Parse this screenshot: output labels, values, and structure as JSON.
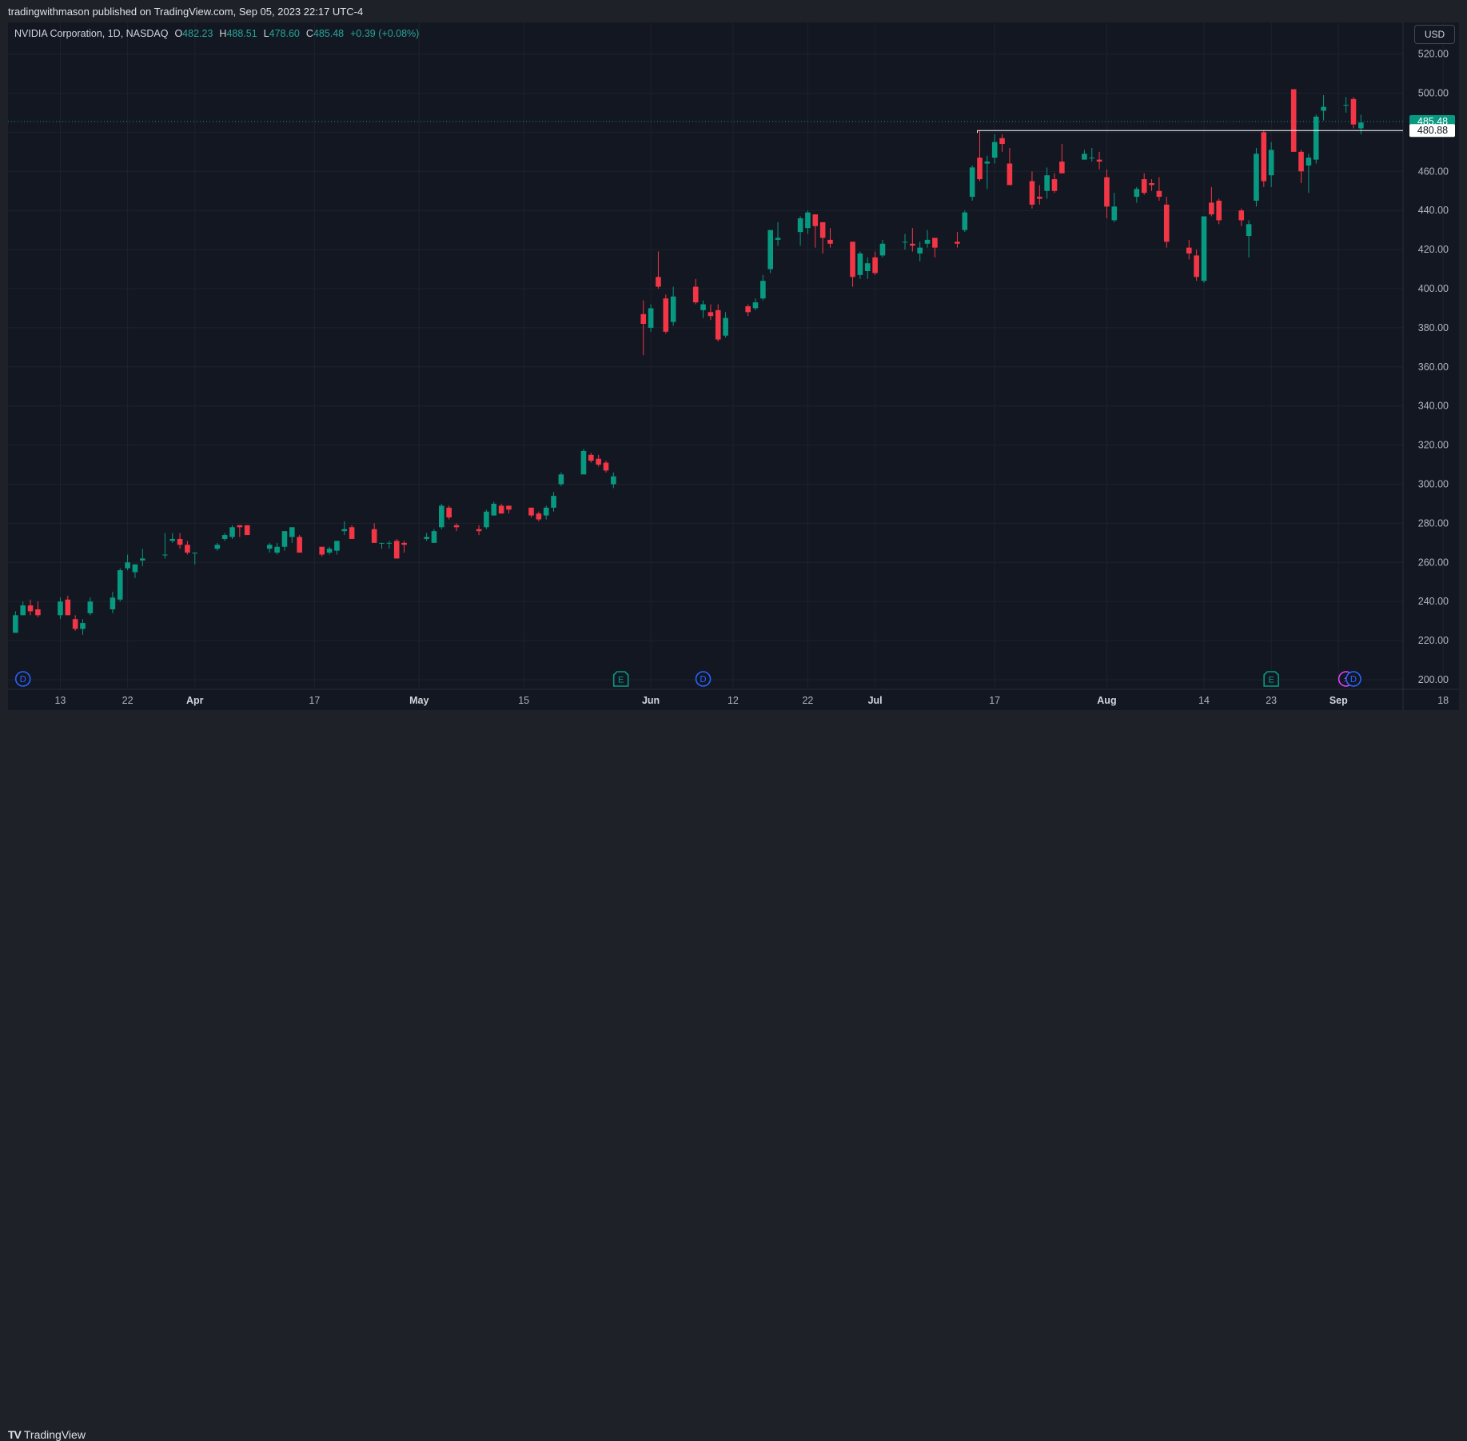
{
  "header": {
    "published_text": "tradingwithmason published on TradingView.com, Sep 05, 2023 22:17 UTC-4"
  },
  "legend": {
    "symbol": "NVIDIA Corporation, 1D, NASDAQ",
    "o_label": "O",
    "o_value": "482.23",
    "h_label": "H",
    "h_value": "488.51",
    "l_label": "L",
    "l_value": "478.60",
    "c_label": "C",
    "c_value": "485.48",
    "change": "+0.39 (+0.08%)"
  },
  "currency_button": "USD",
  "footer": {
    "brand": "TradingView",
    "logo_icon": "tradingview-logo-icon"
  },
  "colors": {
    "up": "#089981",
    "down": "#f23645",
    "background": "#131722",
    "grid": "#232632",
    "text": "#b2b5be",
    "dividend_marker": "#2962ff",
    "earnings_marker": "#089981",
    "split_marker": "#e040fb"
  },
  "chart_data": {
    "type": "candlestick",
    "title": "NVIDIA Corporation, 1D, NASDAQ",
    "currency": "USD",
    "ylim": [
      195,
      530
    ],
    "y_ticks": [
      "520.00",
      "500.00",
      "480.00",
      "460.00",
      "440.00",
      "420.00",
      "400.00",
      "380.00",
      "360.00",
      "340.00",
      "320.00",
      "300.00",
      "280.00",
      "260.00",
      "240.00",
      "220.00",
      "200.00"
    ],
    "x_ticks": [
      {
        "label": "13",
        "day": 7
      },
      {
        "label": "22",
        "day": 16
      },
      {
        "label": "Apr",
        "day": 25
      },
      {
        "label": "17",
        "day": 41
      },
      {
        "label": "May",
        "day": 55
      },
      {
        "label": "15",
        "day": 69
      },
      {
        "label": "Jun",
        "day": 86
      },
      {
        "label": "12",
        "day": 97
      },
      {
        "label": "22",
        "day": 107
      },
      {
        "label": "Jul",
        "day": 116
      },
      {
        "label": "17",
        "day": 132
      },
      {
        "label": "Aug",
        "day": 147
      },
      {
        "label": "14",
        "day": 160
      },
      {
        "label": "23",
        "day": 169
      },
      {
        "label": "Sep",
        "day": 178
      },
      {
        "label": "18",
        "day": 192
      }
    ],
    "candles": [
      {
        "d": 1,
        "o": 224,
        "h": 235,
        "l": 224,
        "c": 233
      },
      {
        "d": 2,
        "o": 233,
        "h": 240,
        "l": 233,
        "c": 238
      },
      {
        "d": 3,
        "o": 238,
        "h": 241,
        "l": 233,
        "c": 235
      },
      {
        "d": 4,
        "o": 236,
        "h": 240,
        "l": 232,
        "c": 233
      },
      {
        "d": 7,
        "o": 233,
        "h": 242,
        "l": 231,
        "c": 240
      },
      {
        "d": 8,
        "o": 241,
        "h": 243,
        "l": 233,
        "c": 233
      },
      {
        "d": 9,
        "o": 231,
        "h": 233,
        "l": 225,
        "c": 226
      },
      {
        "d": 10,
        "o": 226,
        "h": 231,
        "l": 223,
        "c": 229
      },
      {
        "d": 11,
        "o": 234,
        "h": 242,
        "l": 233,
        "c": 240
      },
      {
        "d": 14,
        "o": 236,
        "h": 245,
        "l": 234,
        "c": 242
      },
      {
        "d": 15,
        "o": 241,
        "h": 257,
        "l": 240,
        "c": 256
      },
      {
        "d": 16,
        "o": 257,
        "h": 264,
        "l": 256,
        "c": 260
      },
      {
        "d": 17,
        "o": 255,
        "h": 259,
        "l": 252,
        "c": 259
      },
      {
        "d": 18,
        "o": 261,
        "h": 267,
        "l": 258,
        "c": 262
      },
      {
        "d": 21,
        "o": 264,
        "h": 275,
        "l": 262,
        "c": 264
      },
      {
        "d": 22,
        "o": 271,
        "h": 275,
        "l": 270,
        "c": 272
      },
      {
        "d": 23,
        "o": 272,
        "h": 275,
        "l": 267,
        "c": 269
      },
      {
        "d": 24,
        "o": 269,
        "h": 271,
        "l": 264,
        "c": 265
      },
      {
        "d": 25,
        "o": 265,
        "h": 265,
        "l": 259,
        "c": 265
      },
      {
        "d": 28,
        "o": 267,
        "h": 270,
        "l": 266,
        "c": 269
      },
      {
        "d": 29,
        "o": 272,
        "h": 275,
        "l": 271,
        "c": 274
      },
      {
        "d": 30,
        "o": 273,
        "h": 279,
        "l": 272,
        "c": 278
      },
      {
        "d": 31,
        "o": 279,
        "h": 279,
        "l": 273,
        "c": 278
      },
      {
        "d": 32,
        "o": 279,
        "h": 279,
        "l": 274,
        "c": 274
      },
      {
        "d": 35,
        "o": 267,
        "h": 270,
        "l": 265,
        "c": 269
      },
      {
        "d": 36,
        "o": 265,
        "h": 270,
        "l": 264,
        "c": 268
      },
      {
        "d": 37,
        "o": 268,
        "h": 276,
        "l": 266,
        "c": 276
      },
      {
        "d": 38,
        "o": 273,
        "h": 278,
        "l": 270,
        "c": 278
      },
      {
        "d": 39,
        "o": 273,
        "h": 274,
        "l": 265,
        "c": 265
      },
      {
        "d": 42,
        "o": 268,
        "h": 268,
        "l": 263,
        "c": 264
      },
      {
        "d": 43,
        "o": 265,
        "h": 268,
        "l": 264,
        "c": 267
      },
      {
        "d": 44,
        "o": 266,
        "h": 271,
        "l": 264,
        "c": 271
      },
      {
        "d": 45,
        "o": 276,
        "h": 281,
        "l": 274,
        "c": 277
      },
      {
        "d": 46,
        "o": 278,
        "h": 279,
        "l": 274,
        "c": 272
      },
      {
        "d": 49,
        "o": 277,
        "h": 280,
        "l": 270,
        "c": 270
      },
      {
        "d": 50,
        "o": 270,
        "h": 270,
        "l": 267,
        "c": 270
      },
      {
        "d": 51,
        "o": 270,
        "h": 271,
        "l": 267,
        "c": 270
      },
      {
        "d": 52,
        "o": 271,
        "h": 272,
        "l": 262,
        "c": 262
      },
      {
        "d": 53,
        "o": 270,
        "h": 271,
        "l": 265,
        "c": 269
      },
      {
        "d": 56,
        "o": 272,
        "h": 275,
        "l": 271,
        "c": 273
      },
      {
        "d": 57,
        "o": 270,
        "h": 277,
        "l": 270,
        "c": 276
      },
      {
        "d": 58,
        "o": 278,
        "h": 290,
        "l": 277,
        "c": 289
      },
      {
        "d": 59,
        "o": 288,
        "h": 289,
        "l": 282,
        "c": 283
      },
      {
        "d": 60,
        "o": 279,
        "h": 280,
        "l": 276,
        "c": 278
      },
      {
        "d": 63,
        "o": 277,
        "h": 279,
        "l": 274,
        "c": 276
      },
      {
        "d": 64,
        "o": 278,
        "h": 287,
        "l": 277,
        "c": 286
      },
      {
        "d": 65,
        "o": 284,
        "h": 291,
        "l": 284,
        "c": 290
      },
      {
        "d": 66,
        "o": 289,
        "h": 290,
        "l": 285,
        "c": 285
      },
      {
        "d": 67,
        "o": 289,
        "h": 289,
        "l": 285,
        "c": 287
      },
      {
        "d": 70,
        "o": 288,
        "h": 288,
        "l": 283,
        "c": 284
      },
      {
        "d": 71,
        "o": 285,
        "h": 286,
        "l": 281,
        "c": 282
      },
      {
        "d": 72,
        "o": 284,
        "h": 289,
        "l": 282,
        "c": 288
      },
      {
        "d": 73,
        "o": 288,
        "h": 296,
        "l": 286,
        "c": 294
      },
      {
        "d": 74,
        "o": 300,
        "h": 306,
        "l": 299,
        "c": 305
      },
      {
        "d": 77,
        "o": 305,
        "h": 318,
        "l": 305,
        "c": 317
      },
      {
        "d": 78,
        "o": 315,
        "h": 316,
        "l": 311,
        "c": 312
      },
      {
        "d": 79,
        "o": 313,
        "h": 315,
        "l": 309,
        "c": 310
      },
      {
        "d": 80,
        "o": 311,
        "h": 312,
        "l": 306,
        "c": 307
      },
      {
        "d": 81,
        "o": 300,
        "h": 306,
        "l": 298,
        "c": 304
      },
      {
        "d": 85,
        "o": 387,
        "h": 394,
        "l": 366,
        "c": 382
      },
      {
        "d": 86,
        "o": 380,
        "h": 392,
        "l": 378,
        "c": 390
      },
      {
        "d": 87,
        "o": 406,
        "h": 419,
        "l": 400,
        "c": 401
      },
      {
        "d": 88,
        "o": 395,
        "h": 397,
        "l": 377,
        "c": 378
      },
      {
        "d": 89,
        "o": 383,
        "h": 401,
        "l": 381,
        "c": 396
      },
      {
        "d": 92,
        "o": 401,
        "h": 405,
        "l": 392,
        "c": 393
      },
      {
        "d": 93,
        "o": 389,
        "h": 394,
        "l": 385,
        "c": 392
      },
      {
        "d": 94,
        "o": 388,
        "h": 392,
        "l": 384,
        "c": 386
      },
      {
        "d": 95,
        "o": 389,
        "h": 392,
        "l": 373,
        "c": 374
      },
      {
        "d": 96,
        "o": 376,
        "h": 388,
        "l": 375,
        "c": 385
      },
      {
        "d": 99,
        "o": 391,
        "h": 392,
        "l": 386,
        "c": 388
      },
      {
        "d": 100,
        "o": 390,
        "h": 395,
        "l": 389,
        "c": 393
      },
      {
        "d": 101,
        "o": 395,
        "h": 407,
        "l": 394,
        "c": 404
      },
      {
        "d": 102,
        "o": 410,
        "h": 429,
        "l": 408,
        "c": 430
      },
      {
        "d": 103,
        "o": 425,
        "h": 434,
        "l": 422,
        "c": 426
      },
      {
        "d": 106,
        "o": 429,
        "h": 437,
        "l": 422,
        "c": 436
      },
      {
        "d": 107,
        "o": 431,
        "h": 440,
        "l": 428,
        "c": 439
      },
      {
        "d": 108,
        "o": 438,
        "h": 438,
        "l": 421,
        "c": 432
      },
      {
        "d": 109,
        "o": 434,
        "h": 434,
        "l": 418,
        "c": 426
      },
      {
        "d": 110,
        "o": 425,
        "h": 431,
        "l": 421,
        "c": 423
      },
      {
        "d": 113,
        "o": 424,
        "h": 424,
        "l": 401,
        "c": 406
      },
      {
        "d": 114,
        "o": 407,
        "h": 419,
        "l": 405,
        "c": 418
      },
      {
        "d": 115,
        "o": 409,
        "h": 416,
        "l": 405,
        "c": 413
      },
      {
        "d": 116,
        "o": 416,
        "h": 419,
        "l": 407,
        "c": 408
      },
      {
        "d": 117,
        "o": 417,
        "h": 425,
        "l": 416,
        "c": 423
      },
      {
        "d": 120,
        "o": 424,
        "h": 428,
        "l": 420,
        "c": 424
      },
      {
        "d": 121,
        "o": 423,
        "h": 431,
        "l": 419,
        "c": 422
      },
      {
        "d": 122,
        "o": 418,
        "h": 424,
        "l": 414,
        "c": 421
      },
      {
        "d": 123,
        "o": 423,
        "h": 430,
        "l": 421,
        "c": 425
      },
      {
        "d": 124,
        "o": 426,
        "h": 426,
        "l": 416,
        "c": 421
      },
      {
        "d": 127,
        "o": 424,
        "h": 429,
        "l": 421,
        "c": 423
      },
      {
        "d": 128,
        "o": 430,
        "h": 440,
        "l": 429,
        "c": 439
      },
      {
        "d": 129,
        "o": 447,
        "h": 463,
        "l": 445,
        "c": 462
      },
      {
        "d": 130,
        "o": 467,
        "h": 481,
        "l": 455,
        "c": 456
      },
      {
        "d": 131,
        "o": 464,
        "h": 468,
        "l": 451,
        "c": 465
      },
      {
        "d": 132,
        "o": 467,
        "h": 479,
        "l": 464,
        "c": 475
      },
      {
        "d": 133,
        "o": 477,
        "h": 479,
        "l": 470,
        "c": 474
      },
      {
        "d": 134,
        "o": 464,
        "h": 472,
        "l": 453,
        "c": 453
      },
      {
        "d": 137,
        "o": 455,
        "h": 460,
        "l": 441,
        "c": 443
      },
      {
        "d": 138,
        "o": 447,
        "h": 453,
        "l": 443,
        "c": 446
      },
      {
        "d": 139,
        "o": 450,
        "h": 462,
        "l": 446,
        "c": 458
      },
      {
        "d": 140,
        "o": 456,
        "h": 459,
        "l": 449,
        "c": 450
      },
      {
        "d": 141,
        "o": 465,
        "h": 474,
        "l": 459,
        "c": 459
      },
      {
        "d": 144,
        "o": 466,
        "h": 471,
        "l": 466,
        "c": 469
      },
      {
        "d": 145,
        "o": 467,
        "h": 472,
        "l": 465,
        "c": 467
      },
      {
        "d": 146,
        "o": 466,
        "h": 470,
        "l": 461,
        "c": 465
      },
      {
        "d": 147,
        "o": 457,
        "h": 461,
        "l": 436,
        "c": 442
      },
      {
        "d": 148,
        "o": 435,
        "h": 449,
        "l": 434,
        "c": 442
      },
      {
        "d": 151,
        "o": 447,
        "h": 452,
        "l": 444,
        "c": 451
      },
      {
        "d": 152,
        "o": 456,
        "h": 459,
        "l": 448,
        "c": 449
      },
      {
        "d": 153,
        "o": 454,
        "h": 456,
        "l": 450,
        "c": 453
      },
      {
        "d": 154,
        "o": 450,
        "h": 457,
        "l": 445,
        "c": 447
      },
      {
        "d": 155,
        "o": 443,
        "h": 447,
        "l": 421,
        "c": 424
      },
      {
        "d": 158,
        "o": 421,
        "h": 425,
        "l": 415,
        "c": 418
      },
      {
        "d": 159,
        "o": 417,
        "h": 420,
        "l": 404,
        "c": 406
      },
      {
        "d": 160,
        "o": 404,
        "h": 437,
        "l": 403,
        "c": 437
      },
      {
        "d": 161,
        "o": 444,
        "h": 452,
        "l": 437,
        "c": 438
      },
      {
        "d": 162,
        "o": 445,
        "h": 446,
        "l": 433,
        "c": 435
      },
      {
        "d": 165,
        "o": 440,
        "h": 441,
        "l": 432,
        "c": 435
      },
      {
        "d": 166,
        "o": 427,
        "h": 435,
        "l": 416,
        "c": 433
      },
      {
        "d": 167,
        "o": 445,
        "h": 472,
        "l": 442,
        "c": 469
      },
      {
        "d": 168,
        "o": 480,
        "h": 481,
        "l": 452,
        "c": 455
      },
      {
        "d": 169,
        "o": 458,
        "h": 475,
        "l": 452,
        "c": 471
      },
      {
        "d": 172,
        "o": 502,
        "h": 502,
        "l": 470,
        "c": 470
      },
      {
        "d": 173,
        "o": 470,
        "h": 471,
        "l": 454,
        "c": 460
      },
      {
        "d": 174,
        "o": 463,
        "h": 469,
        "l": 449,
        "c": 467
      },
      {
        "d": 175,
        "o": 466,
        "h": 489,
        "l": 464,
        "c": 488
      },
      {
        "d": 176,
        "o": 491,
        "h": 499,
        "l": 486,
        "c": 493
      },
      {
        "d": 179,
        "o": 494,
        "h": 498,
        "l": 490,
        "c": 494
      },
      {
        "d": 180,
        "o": 497,
        "h": 498,
        "l": 482,
        "c": 484
      },
      {
        "d": 181,
        "o": 482,
        "h": 489,
        "l": 479,
        "c": 485
      }
    ],
    "horizontal_level": {
      "value": 480.88,
      "label": "480.88",
      "from_day": 130
    },
    "last_price": {
      "value": 485.48,
      "label": "485.48"
    },
    "events": [
      {
        "day": 2,
        "type": "dividend",
        "label": "D"
      },
      {
        "day": 82,
        "type": "earnings",
        "label": "E"
      },
      {
        "day": 93,
        "type": "dividend",
        "label": "D"
      },
      {
        "day": 169,
        "type": "earnings",
        "label": "E"
      },
      {
        "day": 179,
        "type": "split",
        "label": "⚡"
      },
      {
        "day": 180,
        "type": "dividend",
        "label": "D"
      }
    ]
  }
}
